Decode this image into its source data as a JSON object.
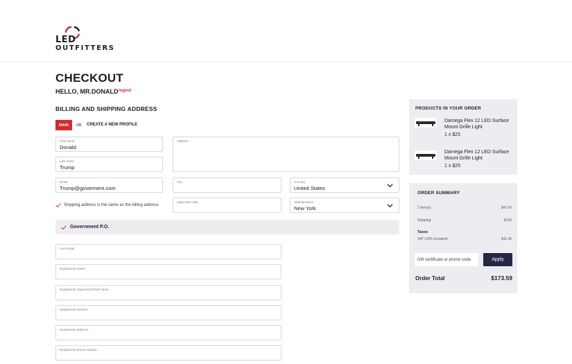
{
  "brand": {
    "logo_line1": "LED",
    "logo_line2": "OUTFITTERS",
    "accent": "#d9262c",
    "dark": "#262744"
  },
  "page": {
    "title": "CHECKOUT",
    "greeting": "HELLO, MR.DONALD",
    "logout": "logout"
  },
  "billing": {
    "heading": "BILLING AND SHIPPING ADDRESS",
    "tab_main": "MAIN",
    "or": "OR",
    "create_profile": "CREATE A NEW PROFILE",
    "first_name": {
      "label": "First name",
      "value": "Donald"
    },
    "last_name": {
      "label": "Last name",
      "value": "Trump"
    },
    "address": {
      "label": "Address",
      "value": ""
    },
    "email": {
      "label": "Email",
      "value": "Trump@goverment.com"
    },
    "city": {
      "label": "City",
      "value": ""
    },
    "country": {
      "label": "Country:",
      "value": "United States"
    },
    "zip": {
      "label": "Zip/postal code",
      "value": ""
    },
    "state": {
      "label": "State/province",
      "value": "New York"
    },
    "same_address": "Shipping address is the same as the billing address"
  },
  "government": {
    "label": "Government P.O.",
    "fields": [
      {
        "label": "Your email"
      },
      {
        "label": "Department name:"
      },
      {
        "label": "Department Supervisor/Chief name:"
      },
      {
        "label": "Department website:"
      },
      {
        "label": "Department address:"
      },
      {
        "label": "Department phone number:"
      }
    ]
  },
  "order": {
    "heading": "PRODUCTS IN YOUR ORDER",
    "products": [
      {
        "name": "Damega Flex 12 LED Surface Mount Grille Light",
        "qty": "1 x $25"
      },
      {
        "name": "Damega Flex 12 LED Surface Mount Grille Light",
        "qty": "1 x $25"
      }
    ]
  },
  "summary": {
    "heading": "ORDER SUMMARY",
    "items_label": "2 item(s)",
    "items_value": "$47.69",
    "shipping_label": "Shipping",
    "shipping_value": "$126",
    "taxes_heading": "Taxes",
    "vat_label": "VAT (10% included)",
    "vat_value": "$11.46",
    "promo_placeholder": "Gift certificate or promo code",
    "apply": "Apply",
    "total_label": "Order Total",
    "total_value": "$173.59"
  }
}
